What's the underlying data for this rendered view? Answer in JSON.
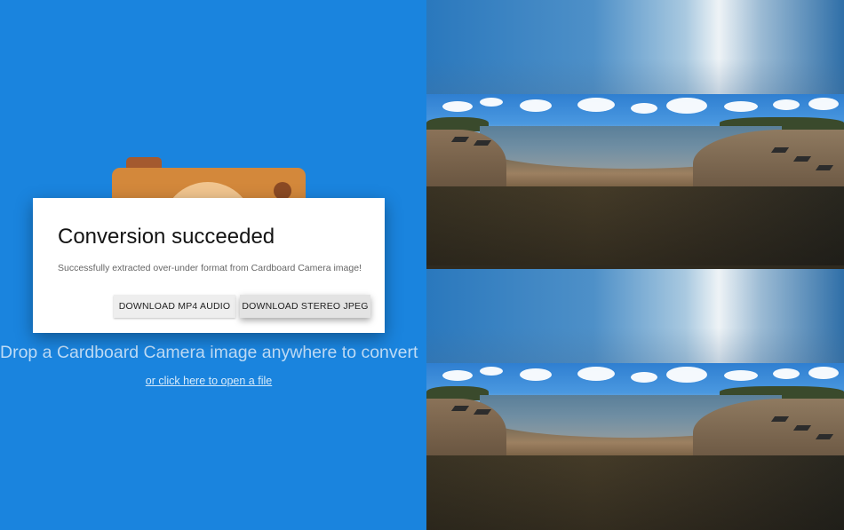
{
  "dialog": {
    "title": "Conversion succeeded",
    "message": "Successfully extracted over-under format from Cardboard Camera image!",
    "buttons": {
      "download_audio": "DOWNLOAD MP4 AUDIO",
      "download_jpeg": "DOWNLOAD STEREO JPEG"
    }
  },
  "dropzone": {
    "prompt": "Drop a Cardboard Camera image anywhere to convert",
    "open_link": "or click here to open a file"
  },
  "preview": {
    "layout": "over-under",
    "views": [
      "top",
      "bottom"
    ]
  },
  "colors": {
    "background": "#1a84de",
    "dialog": "#ffffff",
    "camera_body": "#d3883b"
  },
  "icons": {
    "app": "cardboard-camera-icon"
  }
}
